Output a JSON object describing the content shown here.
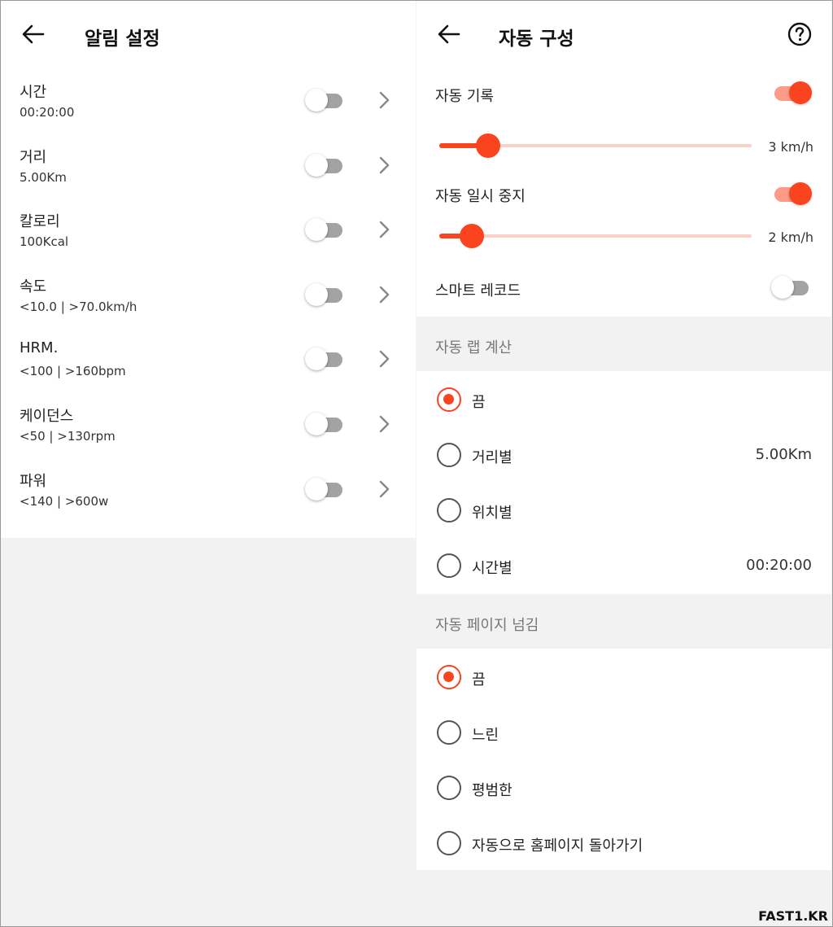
{
  "left_panel": {
    "title": "알림 설정",
    "items": [
      {
        "label": "시간",
        "value": "00:20:00",
        "enabled": false
      },
      {
        "label": "거리",
        "value": "5.00Km",
        "enabled": false
      },
      {
        "label": "칼로리",
        "value": "100Kcal",
        "enabled": false
      },
      {
        "label": "속도",
        "value": "<10.0 | >70.0km/h",
        "enabled": false
      },
      {
        "label": "HRM.",
        "value": "<100 | >160bpm",
        "enabled": false
      },
      {
        "label": "케이던스",
        "value": "<50 | >130rpm",
        "enabled": false
      },
      {
        "label": "파워",
        "value": "<140 | >600w",
        "enabled": false
      }
    ]
  },
  "right_panel": {
    "title": "자동 구성",
    "auto_record": {
      "label": "자동 기록",
      "enabled": true,
      "slider_value": "3 km/h",
      "slider_fraction": 0.155
    },
    "auto_pause": {
      "label": "자동 일시 중지",
      "enabled": true,
      "slider_value": "2 km/h",
      "slider_fraction": 0.105
    },
    "smart_record": {
      "label": "스마트 레코드",
      "enabled": false
    },
    "auto_lap": {
      "header": "자동 랩 계산",
      "options": [
        {
          "label": "끔",
          "value": "",
          "selected": true
        },
        {
          "label": "거리별",
          "value": "5.00Km",
          "selected": false
        },
        {
          "label": "위치별",
          "value": "",
          "selected": false
        },
        {
          "label": "시간별",
          "value": "00:20:00",
          "selected": false
        }
      ]
    },
    "auto_page": {
      "header": "자동 페이지 넘김",
      "options": [
        {
          "label": "끔",
          "selected": true
        },
        {
          "label": "느린",
          "selected": false
        },
        {
          "label": "평범한",
          "selected": false
        },
        {
          "label": "자동으로 홈페이지 돌아가기",
          "selected": false
        }
      ]
    }
  },
  "watermark": "FAST1.KR",
  "colors": {
    "accent": "#f9441f",
    "accent_light": "#fb9b88",
    "toggle_off": "#a3a3a3"
  },
  "icons": {
    "back": "arrow-left-icon",
    "chevron": "chevron-right-icon",
    "help": "question-circle-icon"
  }
}
